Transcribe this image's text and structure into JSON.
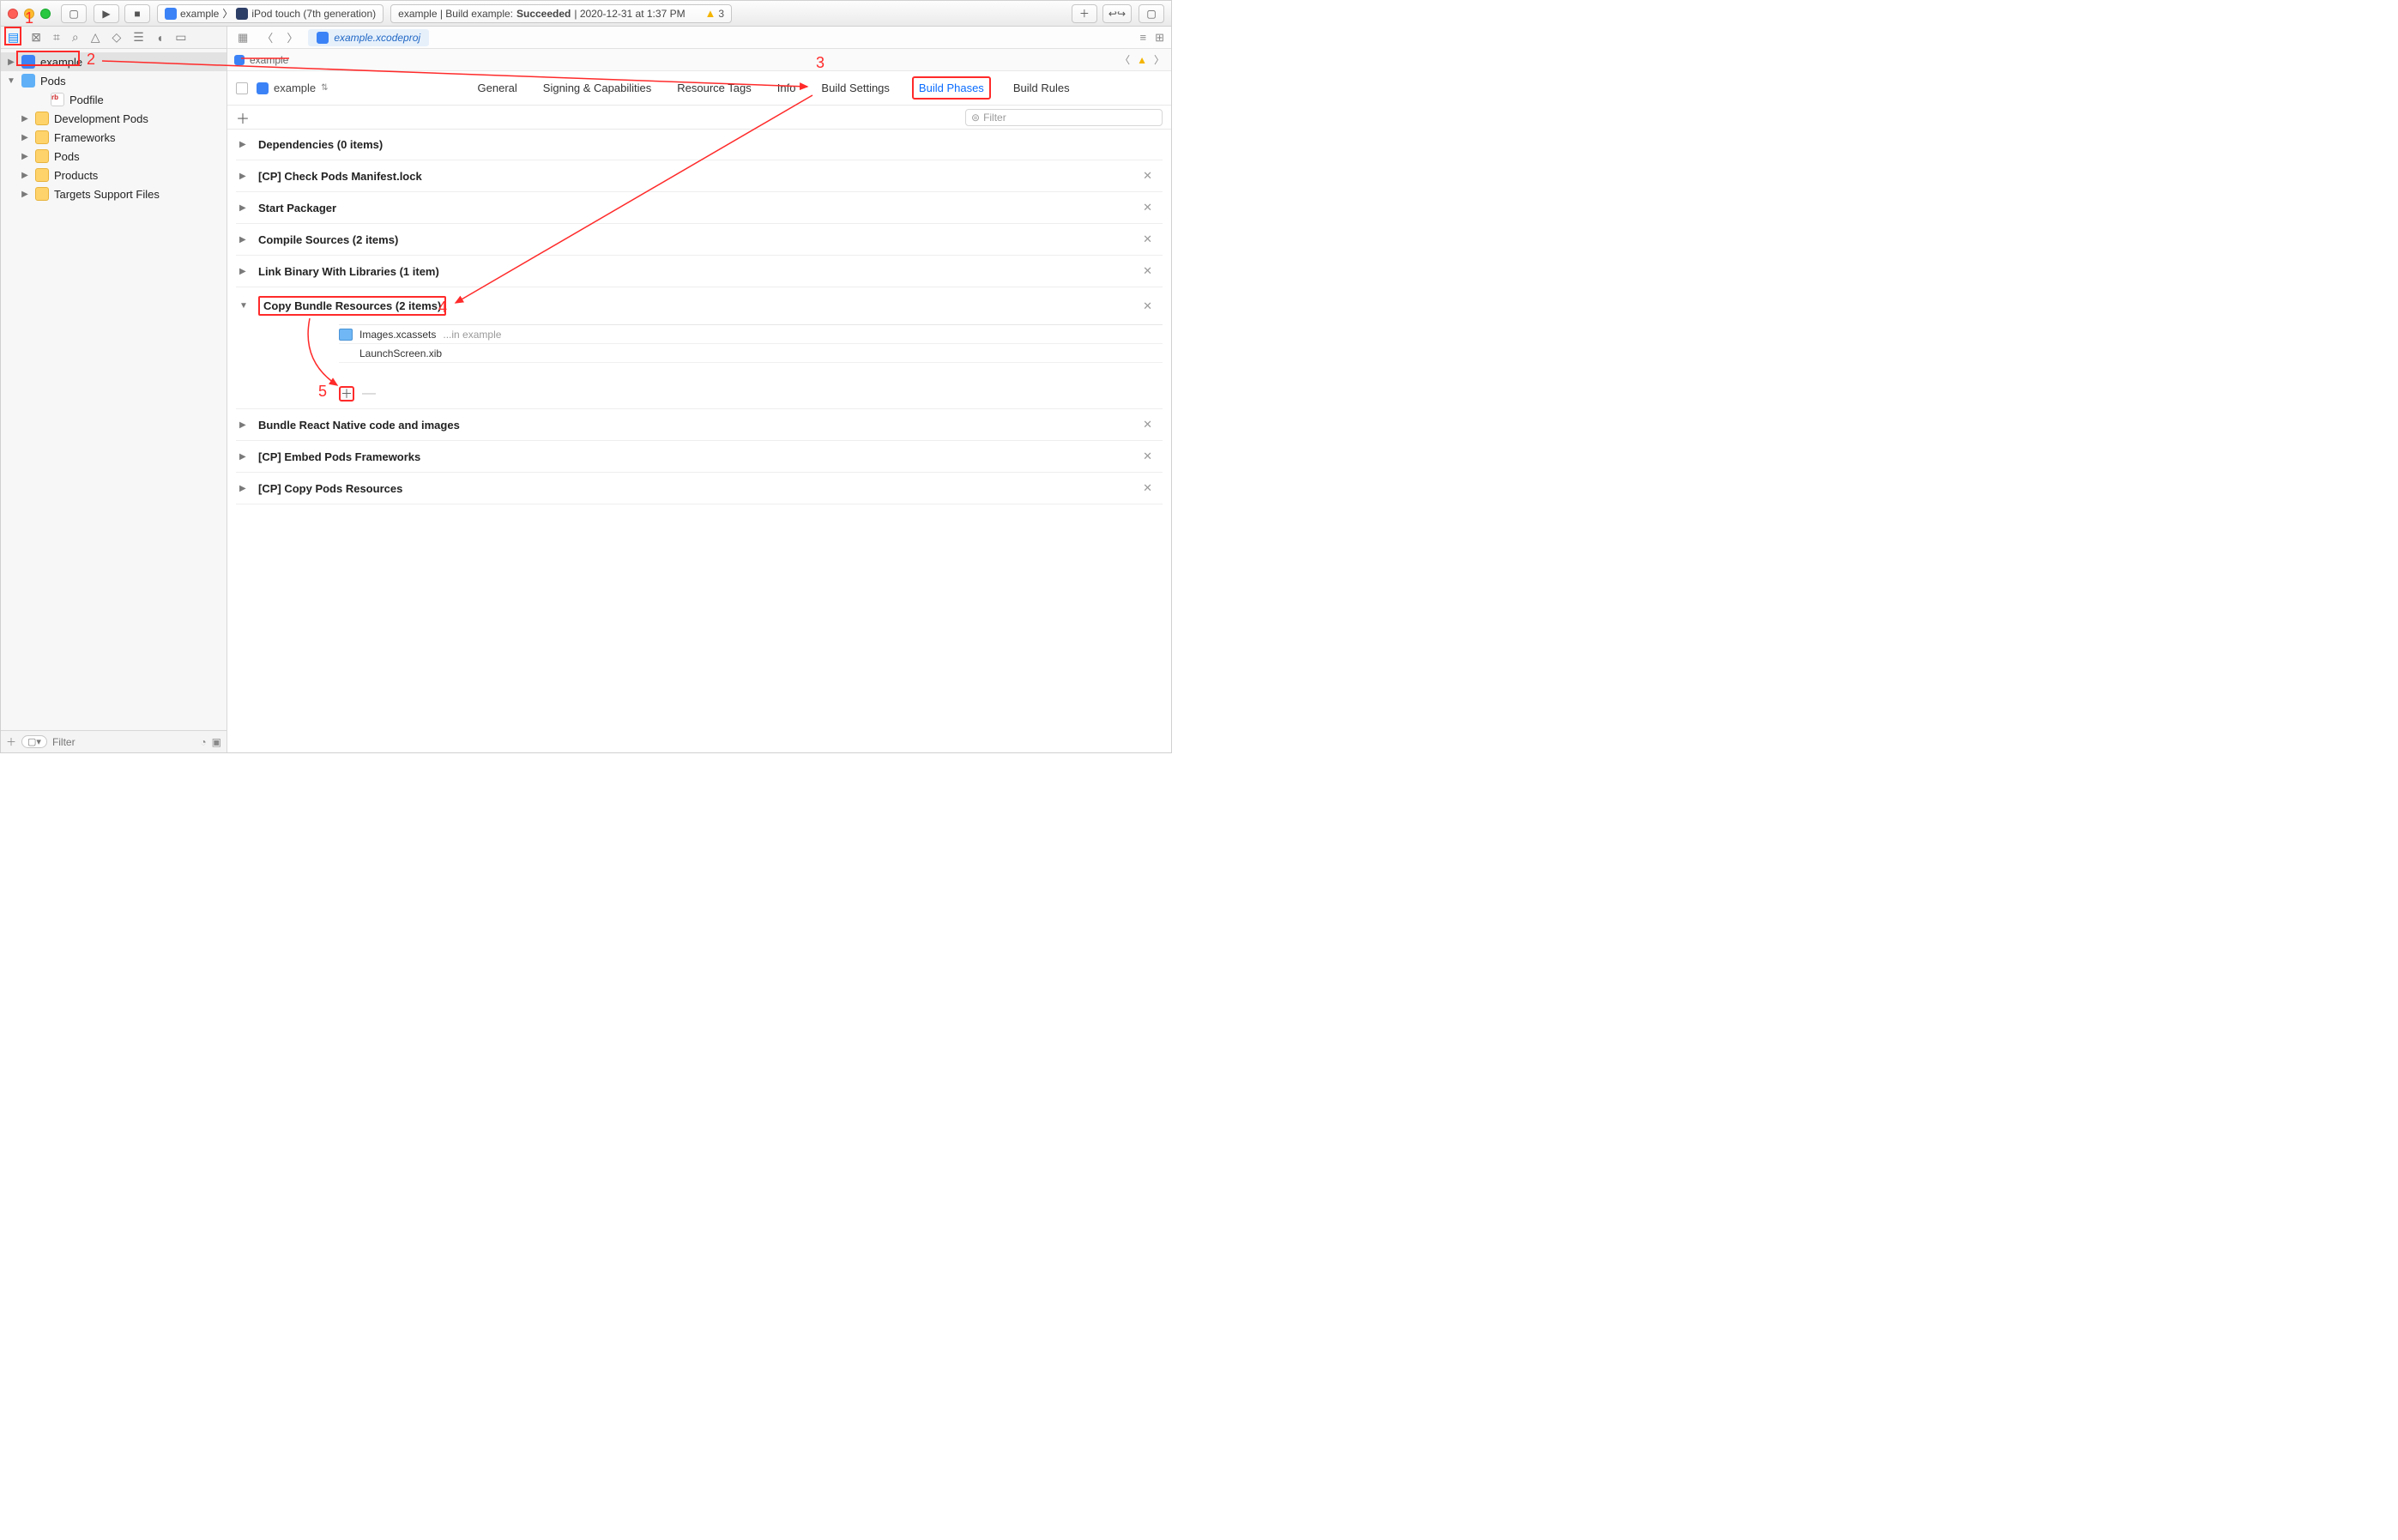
{
  "titlebar": {
    "scheme_target": "example",
    "scheme_device": "iPod touch (7th generation)",
    "status_prefix": "example | Build example: ",
    "status_result": "Succeeded",
    "status_time": " | 2020-12-31 at 1:37 PM",
    "warning_count": "3"
  },
  "pathbar": {
    "tab_label": "example.xcodeproj"
  },
  "crumb": {
    "project": "example"
  },
  "navigator": {
    "root": "example",
    "pods_root": "Pods",
    "podfile": "Podfile",
    "folders": [
      "Development Pods",
      "Frameworks",
      "Pods",
      "Products",
      "Targets Support Files"
    ],
    "filter_placeholder": "Filter"
  },
  "target_header": {
    "name": "example"
  },
  "tabs": {
    "general": "General",
    "signing": "Signing & Capabilities",
    "resource_tags": "Resource Tags",
    "info": "Info",
    "build_settings": "Build Settings",
    "build_phases": "Build Phases",
    "build_rules": "Build Rules"
  },
  "sub_toolbar": {
    "filter_placeholder": "Filter"
  },
  "phases": {
    "dependencies": "Dependencies (0 items)",
    "check_pods": "[CP] Check Pods Manifest.lock",
    "start_packager": "Start Packager",
    "compile_sources": "Compile Sources (2 items)",
    "link_binary": "Link Binary With Libraries (1 item)",
    "copy_bundle": "Copy Bundle Resources (2 items)",
    "bundle_rn": "Bundle React Native code and images",
    "embed_pods": "[CP] Embed Pods Frameworks",
    "copy_pods": "[CP] Copy Pods Resources"
  },
  "cbr": {
    "row1_name": "Images.xcassets",
    "row1_loc": "...in example",
    "row2_name": "LaunchScreen.xib"
  },
  "annotations": {
    "n1": "1",
    "n2": "2",
    "n3": "3",
    "n4": "4",
    "n5": "5"
  }
}
